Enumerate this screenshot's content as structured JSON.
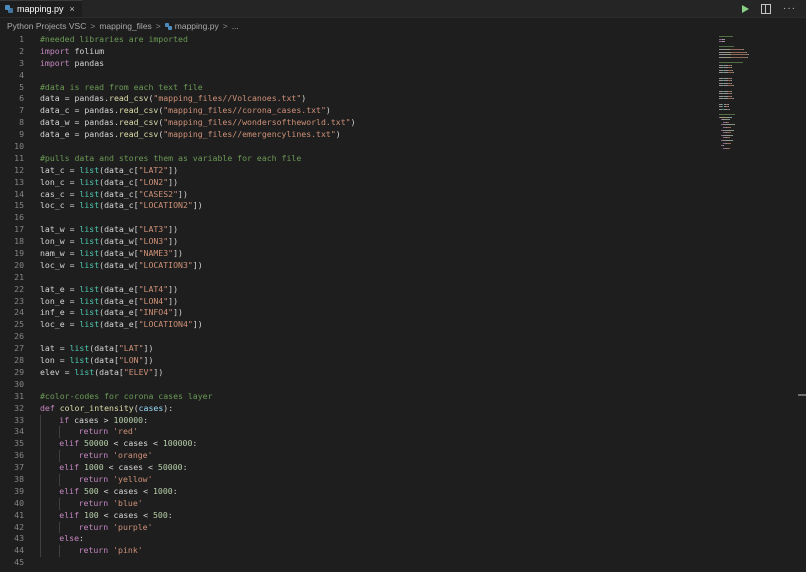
{
  "tab": {
    "label": "mapping.py",
    "close": "×",
    "icon": "python-icon"
  },
  "actions": {
    "run_icon": "play-icon",
    "split_icon": "split-editor-icon",
    "more": "···"
  },
  "breadcrumb": {
    "items": [
      "Python Projects VSC",
      "mapping_files",
      "mapping.py",
      "..."
    ],
    "separator": ">"
  },
  "colors": {
    "background": "#1e1e1e",
    "comment": "#6a9955",
    "keyword": "#c586c0",
    "function": "#dcdcaa",
    "builtin": "#4ec9b0",
    "string": "#ce9178",
    "number": "#b5cea8",
    "param": "#9cdcfe",
    "plain": "#d4d4d4",
    "line_number": "#858585"
  },
  "lines": [
    {
      "n": "1",
      "tokens": [
        [
          "comment",
          "#needed libraries are imported"
        ]
      ]
    },
    {
      "n": "2",
      "tokens": [
        [
          "keyword",
          "import"
        ],
        [
          "plain",
          " folium"
        ]
      ]
    },
    {
      "n": "3",
      "tokens": [
        [
          "keyword",
          "import"
        ],
        [
          "plain",
          " pandas"
        ]
      ]
    },
    {
      "n": "4",
      "tokens": []
    },
    {
      "n": "5",
      "tokens": [
        [
          "comment",
          "#data is read from each text file"
        ]
      ]
    },
    {
      "n": "6",
      "tokens": [
        [
          "plain",
          "data = pandas."
        ],
        [
          "func",
          "read_csv"
        ],
        [
          "plain",
          "("
        ],
        [
          "string",
          "\"mapping_files//Volcanoes.txt\""
        ],
        [
          "plain",
          ")"
        ]
      ]
    },
    {
      "n": "7",
      "tokens": [
        [
          "plain",
          "data_c = pandas."
        ],
        [
          "func",
          "read_csv"
        ],
        [
          "plain",
          "("
        ],
        [
          "string",
          "\"mapping_files//corona_cases.txt\""
        ],
        [
          "plain",
          ")"
        ]
      ]
    },
    {
      "n": "8",
      "tokens": [
        [
          "plain",
          "data_w = pandas."
        ],
        [
          "func",
          "read_csv"
        ],
        [
          "plain",
          "("
        ],
        [
          "string",
          "\"mapping_files//wondersoftheworld.txt\""
        ],
        [
          "plain",
          ")"
        ]
      ]
    },
    {
      "n": "9",
      "tokens": [
        [
          "plain",
          "data_e = pandas."
        ],
        [
          "func",
          "read_csv"
        ],
        [
          "plain",
          "("
        ],
        [
          "string",
          "\"mapping_files//emergencylines.txt\""
        ],
        [
          "plain",
          ")"
        ]
      ]
    },
    {
      "n": "10",
      "tokens": []
    },
    {
      "n": "11",
      "tokens": [
        [
          "comment",
          "#pulls data and stores them as variable for each file"
        ]
      ]
    },
    {
      "n": "12",
      "tokens": [
        [
          "plain",
          "lat_c = "
        ],
        [
          "builtin",
          "list"
        ],
        [
          "plain",
          "(data_c["
        ],
        [
          "string",
          "\"LAT2\""
        ],
        [
          "plain",
          "])"
        ]
      ]
    },
    {
      "n": "13",
      "tokens": [
        [
          "plain",
          "lon_c = "
        ],
        [
          "builtin",
          "list"
        ],
        [
          "plain",
          "(data_c["
        ],
        [
          "string",
          "\"LON2\""
        ],
        [
          "plain",
          "])"
        ]
      ]
    },
    {
      "n": "14",
      "tokens": [
        [
          "plain",
          "cas_c = "
        ],
        [
          "builtin",
          "list"
        ],
        [
          "plain",
          "(data_c["
        ],
        [
          "string",
          "\"CASES2\""
        ],
        [
          "plain",
          "])"
        ]
      ]
    },
    {
      "n": "15",
      "tokens": [
        [
          "plain",
          "loc_c = "
        ],
        [
          "builtin",
          "list"
        ],
        [
          "plain",
          "(data_c["
        ],
        [
          "string",
          "\"LOCATION2\""
        ],
        [
          "plain",
          "])"
        ]
      ]
    },
    {
      "n": "16",
      "tokens": []
    },
    {
      "n": "17",
      "tokens": [
        [
          "plain",
          "lat_w = "
        ],
        [
          "builtin",
          "list"
        ],
        [
          "plain",
          "(data_w["
        ],
        [
          "string",
          "\"LAT3\""
        ],
        [
          "plain",
          "])"
        ]
      ]
    },
    {
      "n": "18",
      "tokens": [
        [
          "plain",
          "lon_w = "
        ],
        [
          "builtin",
          "list"
        ],
        [
          "plain",
          "(data_w["
        ],
        [
          "string",
          "\"LON3\""
        ],
        [
          "plain",
          "])"
        ]
      ]
    },
    {
      "n": "19",
      "tokens": [
        [
          "plain",
          "nam_w = "
        ],
        [
          "builtin",
          "list"
        ],
        [
          "plain",
          "(data_w["
        ],
        [
          "string",
          "\"NAME3\""
        ],
        [
          "plain",
          "])"
        ]
      ]
    },
    {
      "n": "20",
      "tokens": [
        [
          "plain",
          "loc_w = "
        ],
        [
          "builtin",
          "list"
        ],
        [
          "plain",
          "(data_w["
        ],
        [
          "string",
          "\"LOCATION3\""
        ],
        [
          "plain",
          "])"
        ]
      ]
    },
    {
      "n": "21",
      "tokens": []
    },
    {
      "n": "22",
      "tokens": [
        [
          "plain",
          "lat_e = "
        ],
        [
          "builtin",
          "list"
        ],
        [
          "plain",
          "(data_e["
        ],
        [
          "string",
          "\"LAT4\""
        ],
        [
          "plain",
          "])"
        ]
      ]
    },
    {
      "n": "23",
      "tokens": [
        [
          "plain",
          "lon_e = "
        ],
        [
          "builtin",
          "list"
        ],
        [
          "plain",
          "(data_e["
        ],
        [
          "string",
          "\"LON4\""
        ],
        [
          "plain",
          "])"
        ]
      ]
    },
    {
      "n": "24",
      "tokens": [
        [
          "plain",
          "inf_e = "
        ],
        [
          "builtin",
          "list"
        ],
        [
          "plain",
          "(data_e["
        ],
        [
          "string",
          "\"INFO4\""
        ],
        [
          "plain",
          "])"
        ]
      ]
    },
    {
      "n": "25",
      "tokens": [
        [
          "plain",
          "loc_e = "
        ],
        [
          "builtin",
          "list"
        ],
        [
          "plain",
          "(data_e["
        ],
        [
          "string",
          "\"LOCATION4\""
        ],
        [
          "plain",
          "])"
        ]
      ]
    },
    {
      "n": "26",
      "tokens": []
    },
    {
      "n": "27",
      "tokens": [
        [
          "plain",
          "lat = "
        ],
        [
          "builtin",
          "list"
        ],
        [
          "plain",
          "(data["
        ],
        [
          "string",
          "\"LAT\""
        ],
        [
          "plain",
          "])"
        ]
      ]
    },
    {
      "n": "28",
      "tokens": [
        [
          "plain",
          "lon = "
        ],
        [
          "builtin",
          "list"
        ],
        [
          "plain",
          "(data["
        ],
        [
          "string",
          "\"LON\""
        ],
        [
          "plain",
          "])"
        ]
      ]
    },
    {
      "n": "29",
      "tokens": [
        [
          "plain",
          "elev = "
        ],
        [
          "builtin",
          "list"
        ],
        [
          "plain",
          "(data["
        ],
        [
          "string",
          "\"ELEV\""
        ],
        [
          "plain",
          "])"
        ]
      ]
    },
    {
      "n": "30",
      "tokens": []
    },
    {
      "n": "31",
      "tokens": [
        [
          "comment",
          "#color-codes for corona cases layer"
        ]
      ]
    },
    {
      "n": "32",
      "tokens": [
        [
          "keyword",
          "def"
        ],
        [
          "plain",
          " "
        ],
        [
          "func",
          "color_intensity"
        ],
        [
          "plain",
          "("
        ],
        [
          "param",
          "cases"
        ],
        [
          "plain",
          "):"
        ]
      ]
    },
    {
      "n": "33",
      "indent": 1,
      "tokens": [
        [
          "keyword",
          "if"
        ],
        [
          "plain",
          " cases > "
        ],
        [
          "number",
          "100000"
        ],
        [
          "plain",
          ":"
        ]
      ]
    },
    {
      "n": "34",
      "indent": 2,
      "tokens": [
        [
          "keyword",
          "return"
        ],
        [
          "plain",
          " "
        ],
        [
          "string",
          "'red'"
        ]
      ]
    },
    {
      "n": "35",
      "indent": 1,
      "tokens": [
        [
          "keyword",
          "elif"
        ],
        [
          "plain",
          " "
        ],
        [
          "number",
          "50000"
        ],
        [
          "plain",
          " < cases < "
        ],
        [
          "number",
          "100000"
        ],
        [
          "plain",
          ":"
        ]
      ]
    },
    {
      "n": "36",
      "indent": 2,
      "tokens": [
        [
          "keyword",
          "return"
        ],
        [
          "plain",
          " "
        ],
        [
          "string",
          "'orange'"
        ]
      ]
    },
    {
      "n": "37",
      "indent": 1,
      "tokens": [
        [
          "keyword",
          "elif"
        ],
        [
          "plain",
          " "
        ],
        [
          "number",
          "1000"
        ],
        [
          "plain",
          " < cases < "
        ],
        [
          "number",
          "50000"
        ],
        [
          "plain",
          ":"
        ]
      ]
    },
    {
      "n": "38",
      "indent": 2,
      "tokens": [
        [
          "keyword",
          "return"
        ],
        [
          "plain",
          " "
        ],
        [
          "string",
          "'yellow'"
        ]
      ]
    },
    {
      "n": "39",
      "indent": 1,
      "tokens": [
        [
          "keyword",
          "elif"
        ],
        [
          "plain",
          " "
        ],
        [
          "number",
          "500"
        ],
        [
          "plain",
          " < cases < "
        ],
        [
          "number",
          "1000"
        ],
        [
          "plain",
          ":"
        ]
      ]
    },
    {
      "n": "40",
      "indent": 2,
      "tokens": [
        [
          "keyword",
          "return"
        ],
        [
          "plain",
          " "
        ],
        [
          "string",
          "'blue'"
        ]
      ]
    },
    {
      "n": "41",
      "indent": 1,
      "tokens": [
        [
          "keyword",
          "elif"
        ],
        [
          "plain",
          " "
        ],
        [
          "number",
          "100"
        ],
        [
          "plain",
          " < cases < "
        ],
        [
          "number",
          "500"
        ],
        [
          "plain",
          ":"
        ]
      ]
    },
    {
      "n": "42",
      "indent": 2,
      "tokens": [
        [
          "keyword",
          "return"
        ],
        [
          "plain",
          " "
        ],
        [
          "string",
          "'purple'"
        ]
      ]
    },
    {
      "n": "43",
      "indent": 1,
      "tokens": [
        [
          "keyword",
          "else"
        ],
        [
          "plain",
          ":"
        ]
      ]
    },
    {
      "n": "44",
      "indent": 2,
      "tokens": [
        [
          "keyword",
          "return"
        ],
        [
          "plain",
          " "
        ],
        [
          "string",
          "'pink'"
        ]
      ]
    },
    {
      "n": "45",
      "tokens": []
    }
  ]
}
